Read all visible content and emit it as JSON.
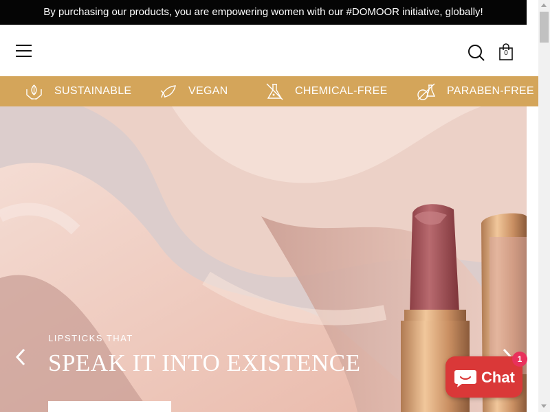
{
  "announcement": {
    "text": "By purchasing our products, you are empowering women with our #DOMOOR initiative, globally!"
  },
  "header": {
    "menu_icon": "hamburger-menu-icon",
    "search_icon": "search-icon",
    "cart_icon": "shopping-bag-icon",
    "cart_count": "0"
  },
  "features": [
    {
      "label": "SUSTAINABLE",
      "icon": "hands-leaf-icon"
    },
    {
      "label": "VEGAN",
      "icon": "leaf-icon"
    },
    {
      "label": "CHEMICAL-FREE",
      "icon": "flask-icon"
    },
    {
      "label": "PARABEN-FREE",
      "icon": "beakers-icon"
    }
  ],
  "hero": {
    "eyebrow": "LIPSTICKS THAT",
    "title": "SPEAK IT INTO EXISTENCE",
    "prev_icon": "chevron-left-icon",
    "next_icon": "chevron-right-icon"
  },
  "chat": {
    "label": "Chat",
    "badge": "1",
    "icon": "chat-bubble-icon"
  },
  "colors": {
    "announcement_bg": "#050505",
    "feature_bar": "#d4a55a",
    "chat_button": "#da3838",
    "chat_badge": "#e8315b"
  }
}
